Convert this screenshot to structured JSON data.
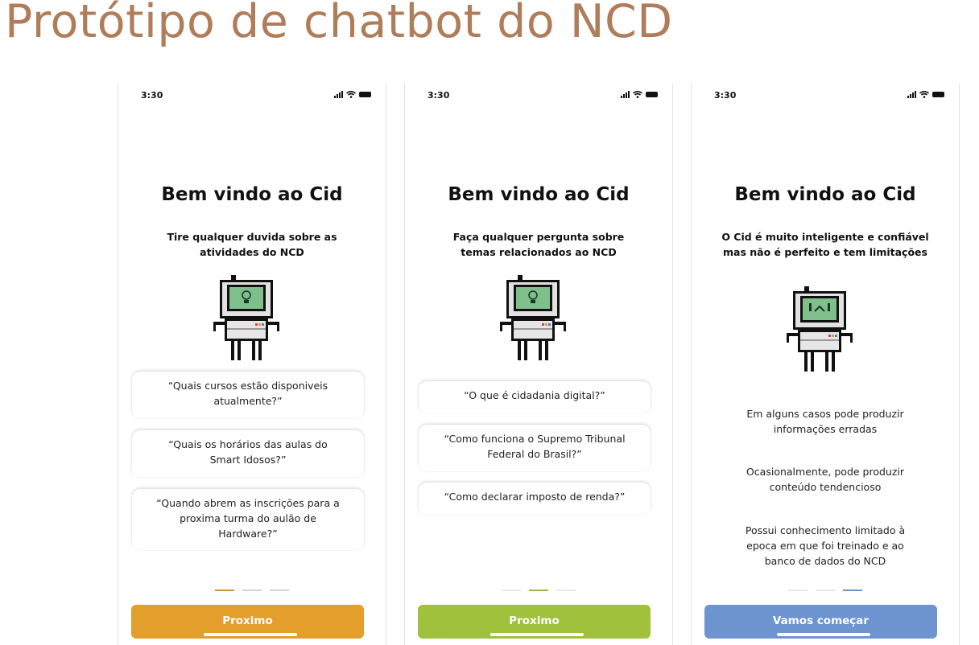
{
  "title": "Protótipo de chatbot do NCD",
  "colors": {
    "title": "#b07d5a",
    "button_orange": "#e39e2c",
    "button_green": "#9fc13c",
    "button_blue": "#6d94cf",
    "screen_green": "#7fbf8c"
  },
  "screens": [
    {
      "time": "3:30",
      "heading": "Bem vindo ao Cid",
      "subtitle": [
        "Tire qualquer duvida sobre as",
        "atividades do NCD"
      ],
      "robot_face": "lightbulb-icon",
      "questions": [
        [
          "“Quais cursos estão disponiveis",
          "atualmente?”"
        ],
        [
          "“Quais os horários das aulas do",
          "Smart Idosos?”"
        ],
        [
          "“Quando abrem as inscrições para a",
          "proxima turma do aulão de",
          "Hardware?”"
        ]
      ],
      "active_page": 1,
      "button": "Proximo"
    },
    {
      "time": "3:30",
      "heading": "Bem vindo ao Cid",
      "subtitle": [
        "Faça qualquer pergunta sobre",
        "temas relacionados ao NCD"
      ],
      "robot_face": "lightbulb-icon",
      "questions": [
        [
          "“O que é cidadania digital?”"
        ],
        [
          "“Como funciona o Supremo Tribunal",
          "Federal do Brasil?”"
        ],
        [
          "“Como declarar imposto de renda?”"
        ]
      ],
      "active_page": 2,
      "button": "Proximo"
    },
    {
      "time": "3:30",
      "heading": "Bem vindo ao Cid",
      "subtitle": [
        "O Cid é muito inteligente e confiável",
        "mas não é perfeito e tem limitações"
      ],
      "robot_face": "sad-face-icon",
      "limitations": [
        [
          "Em alguns casos pode produzir",
          "informações erradas"
        ],
        [
          "Ocasionalmente, pode produzir",
          "conteúdo tendencioso"
        ],
        [
          "Possui conhecimento limitado à",
          "epoca em que foi treinado e ao",
          "banco de dados do NCD"
        ]
      ],
      "active_page": 3,
      "button": "Vamos começar"
    }
  ]
}
